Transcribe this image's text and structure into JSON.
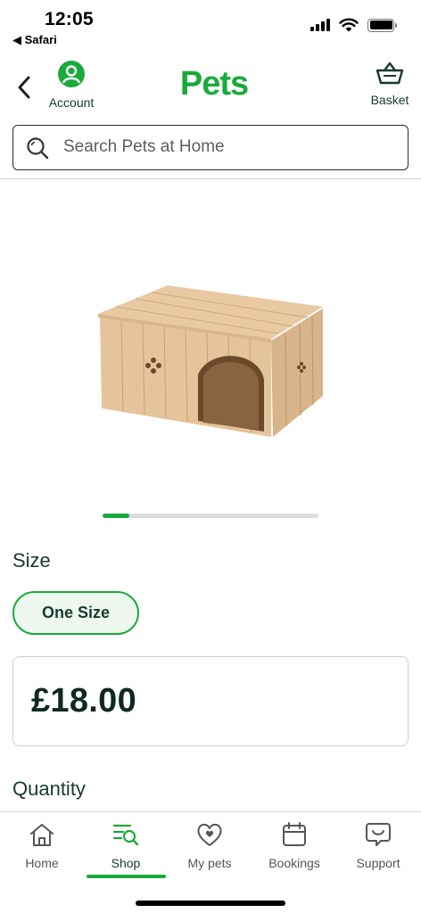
{
  "status_bar": {
    "time": "12:05",
    "back_app": "◀ Safari"
  },
  "header": {
    "account_label": "Account",
    "logo_text": "Pets",
    "basket_label": "Basket"
  },
  "search": {
    "placeholder": "Search Pets at Home"
  },
  "carousel": {
    "progress": 0.125
  },
  "size": {
    "label": "Size",
    "selected": "One Size"
  },
  "price": {
    "value": "£18.00"
  },
  "quantity": {
    "label": "Quantity"
  },
  "nav": {
    "items": [
      {
        "label": "Home",
        "icon": "home-icon"
      },
      {
        "label": "Shop",
        "icon": "shop-search-icon",
        "active": true
      },
      {
        "label": "My pets",
        "icon": "heart-icon"
      },
      {
        "label": "Bookings",
        "icon": "calendar-icon"
      },
      {
        "label": "Support",
        "icon": "chat-support-icon"
      }
    ]
  },
  "colors": {
    "brand_green": "#1AAA3C",
    "dark_green": "#163A2E",
    "chip_bg": "#EEF8EF"
  }
}
